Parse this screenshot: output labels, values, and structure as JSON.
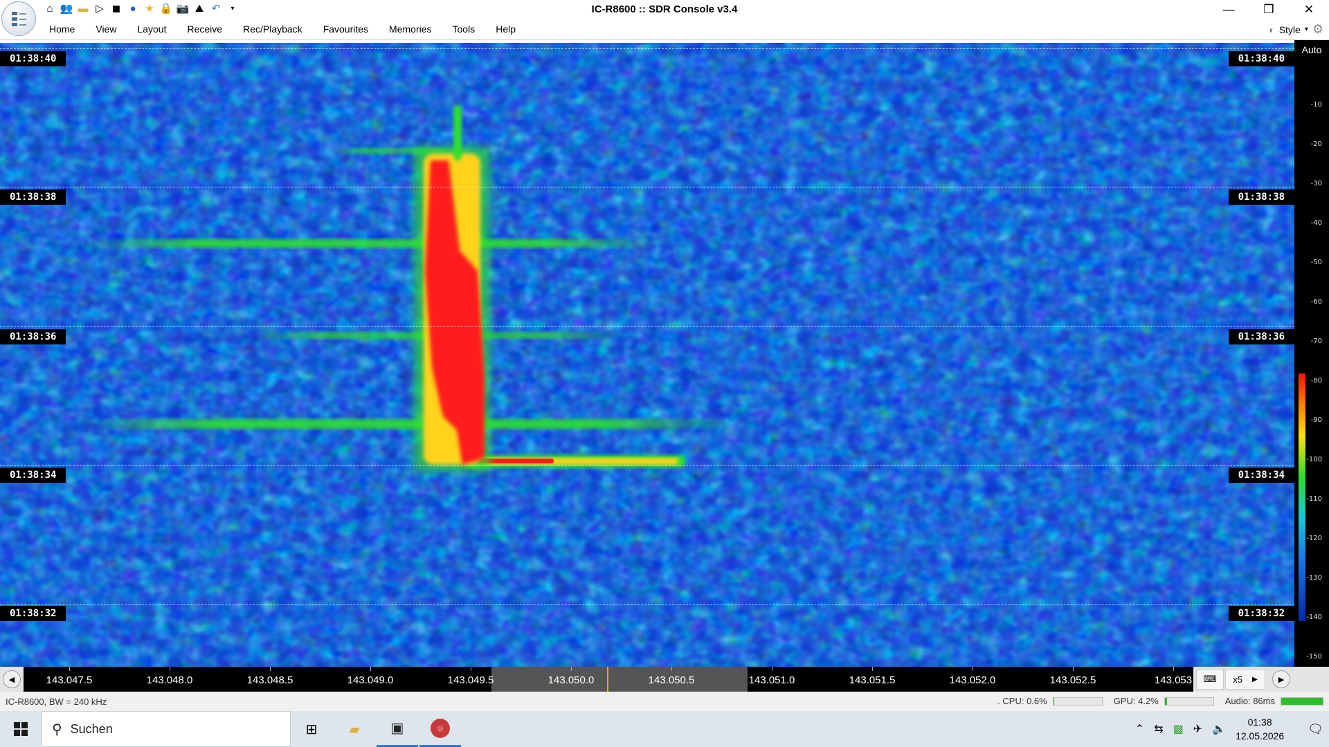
{
  "window": {
    "title": "IC-R8600 :: SDR Console v3.4",
    "controls": [
      "minimize-icon",
      "restore-icon",
      "close-icon"
    ]
  },
  "quick_access": [
    "home-icon",
    "users-icon",
    "folder-icon",
    "play-icon",
    "stop-icon",
    "record-icon",
    "favourite-star-icon",
    "lock-icon",
    "camera-icon",
    "satellite-icon",
    "undo-icon",
    "dropdown-icon"
  ],
  "menu": {
    "items": [
      "Home",
      "View",
      "Layout",
      "Receive",
      "Rec/Playback",
      "Favourites",
      "Memories",
      "Tools",
      "Help"
    ],
    "style_label": "Style"
  },
  "waterfall": {
    "time_labels": [
      "01:38:40",
      "01:38:38",
      "01:38:36",
      "01:38:34",
      "01:38:32"
    ],
    "colors": {
      "background": "#1436c8",
      "noise_light": "#1ea0f0",
      "noise_dark": "#000a3c",
      "signal_core": "#ff1a1a",
      "signal_edge": "#ffd21e",
      "signal_mid": "#2ee02e"
    }
  },
  "db_scale": {
    "mode": "Auto",
    "ticks": [
      "-10",
      "-20",
      "-30",
      "-40",
      "-50",
      "-60",
      "-70",
      "-80",
      "-90",
      "-100",
      "-110",
      "-120",
      "-130",
      "-140",
      "-150"
    ],
    "color_bar_range": [
      "-80",
      "-130"
    ]
  },
  "frequency_axis": {
    "labels": [
      "143.047.5",
      "143.048.0",
      "143.048.5",
      "143.049.0",
      "143.049.5",
      "143.050.0",
      "143.050.5",
      "143.051.0",
      "143.051.5",
      "143.052.0",
      "143.052.5",
      "143.053"
    ],
    "zoom": "x5"
  },
  "status": {
    "device": "IC-R8600, BW = 240 kHz",
    "cpu": ". CPU: 0.6%",
    "cpu_level": 0.006,
    "gpu": "GPU: 4.2%",
    "gpu_level": 0.042,
    "audio": "Audio: 86ms",
    "audio_level": 1.0
  },
  "taskbar": {
    "search_placeholder": "Suchen",
    "time": "01:38",
    "date": "12.05.2026"
  }
}
